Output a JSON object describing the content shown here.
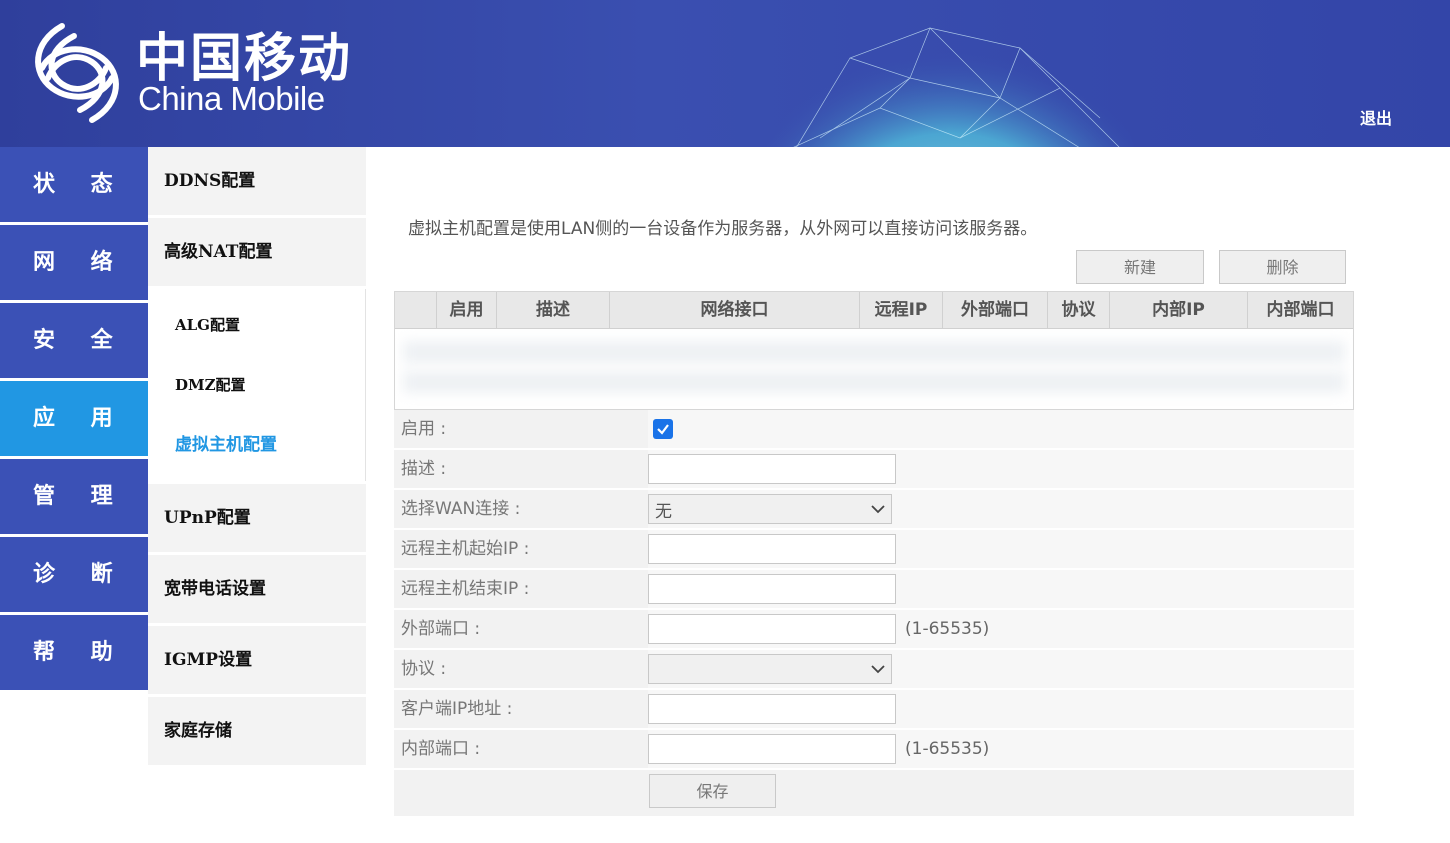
{
  "header": {
    "brand_cn": "中国移动",
    "brand_en": "China Mobile",
    "logout": "退出",
    "colors": {
      "header_bg": "#3345a8",
      "nav_bg": "#3b51b6",
      "nav_active": "#2197e3"
    }
  },
  "main_nav": {
    "items": [
      {
        "label": "状 态"
      },
      {
        "label": "网 络"
      },
      {
        "label": "安 全"
      },
      {
        "label": "应 用",
        "active": true
      },
      {
        "label": "管 理"
      },
      {
        "label": "诊 断"
      },
      {
        "label": "帮 助"
      }
    ]
  },
  "sub_nav": {
    "ddns": "DDNS配置",
    "nat": "高级NAT配置",
    "nat_children": {
      "alg": "ALG配置",
      "dmz": "DMZ配置",
      "vhost": "虚拟主机配置"
    },
    "upnp": "UPnP配置",
    "voip": "宽带电话设置",
    "igmp": "IGMP设置",
    "storage": "家庭存储"
  },
  "content": {
    "description": "虚拟主机配置是使用LAN侧的一台设备作为服务器，从外网可以直接访问该服务器。",
    "new_button": "新建",
    "delete_button": "删除",
    "table": {
      "headers": [
        "启用",
        "描述",
        "网络接口",
        "远程IP",
        "外部端口",
        "协议",
        "内部IP",
        "内部端口"
      ]
    },
    "form": {
      "enable_label": "启用 :",
      "enable_checked": true,
      "desc_label": "描述 :",
      "desc_value": "",
      "wan_label": "选择WAN连接 :",
      "wan_value": "无",
      "remote_start_label": "远程主机起始IP :",
      "remote_start_value": "",
      "remote_end_label": "远程主机结束IP :",
      "remote_end_value": "",
      "ext_port_label": "外部端口 :",
      "ext_port_value": "",
      "ext_port_hint": "(1-65535)",
      "protocol_label": "协议 :",
      "protocol_value": "",
      "client_ip_label": "客户端IP地址 :",
      "client_ip_value": "",
      "int_port_label": "内部端口 :",
      "int_port_value": "",
      "int_port_hint": "(1-65535)",
      "save_button": "保存"
    }
  }
}
